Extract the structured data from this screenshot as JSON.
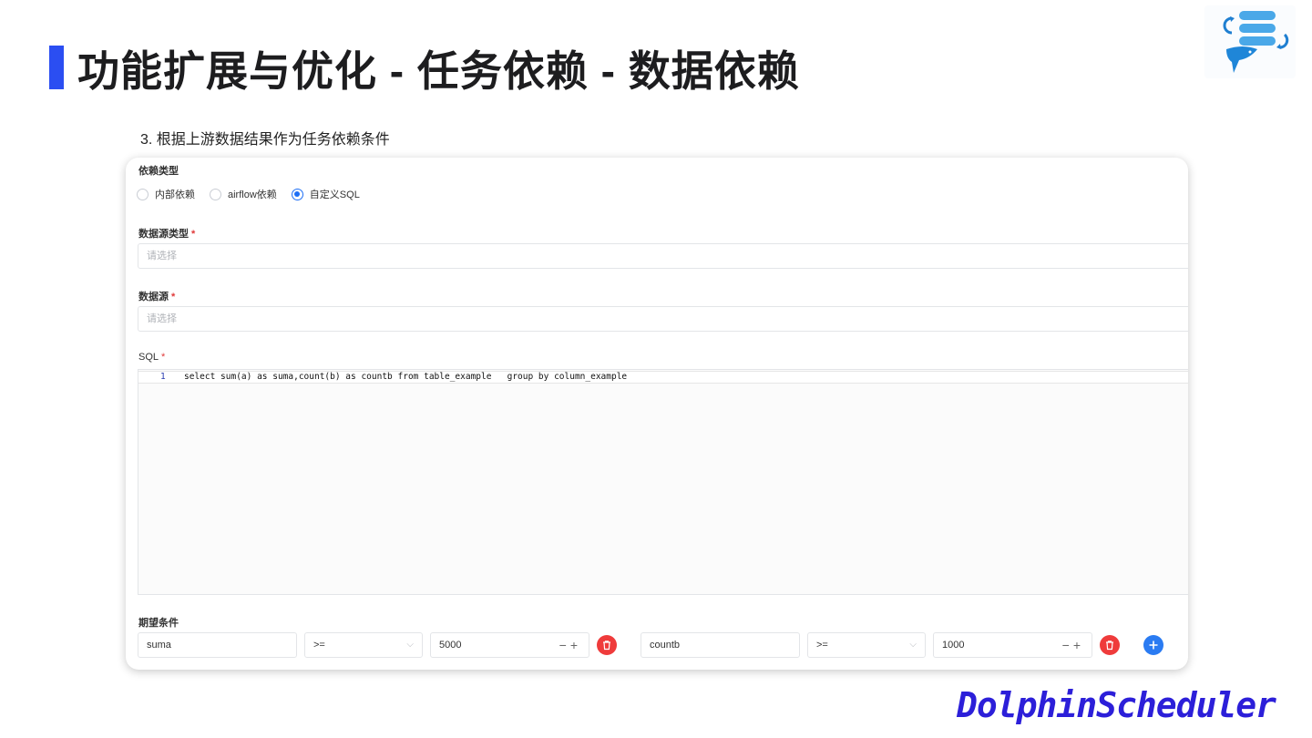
{
  "slide": {
    "title": "功能扩展与优化 - 任务依赖 - 数据依赖",
    "subtitle": "3. 根据上游数据结果作为任务依赖条件",
    "brand": "DolphinScheduler",
    "accent_color": "#2b4ef2"
  },
  "form": {
    "dep_type": {
      "label": "依赖类型",
      "options": [
        {
          "label": "内部依赖",
          "checked": false
        },
        {
          "label": "airflow依赖",
          "checked": false
        },
        {
          "label": "自定义SQL",
          "checked": true
        }
      ]
    },
    "datasource_type": {
      "label": "数据源类型",
      "required_mark": "*",
      "placeholder": "请选择"
    },
    "datasource": {
      "label": "数据源",
      "required_mark": "*",
      "placeholder": "请选择"
    },
    "sql": {
      "label": "SQL",
      "required_mark": "*",
      "line_number": "1",
      "code": "select sum(a) as suma,count(b) as countb from table_example   group by column_example"
    },
    "expect": {
      "label": "期望条件",
      "conditions": [
        {
          "field": "suma",
          "operator": ">=",
          "value": "5000",
          "stepper": "−+"
        },
        {
          "field": "countb",
          "operator": ">=",
          "value": "1000",
          "stepper": "−+"
        }
      ],
      "chevron": "⌵"
    }
  },
  "colors": {
    "delete_button": "#ef3b3b",
    "add_button": "#2a7bf2",
    "radio_checked": "#1e6ff5",
    "required": "#e03a3a",
    "brand_text": "#2c1fd9"
  },
  "icons": {
    "logo": "dolphin-database-logo",
    "delete": "trash-icon",
    "add": "plus-circle-icon"
  }
}
